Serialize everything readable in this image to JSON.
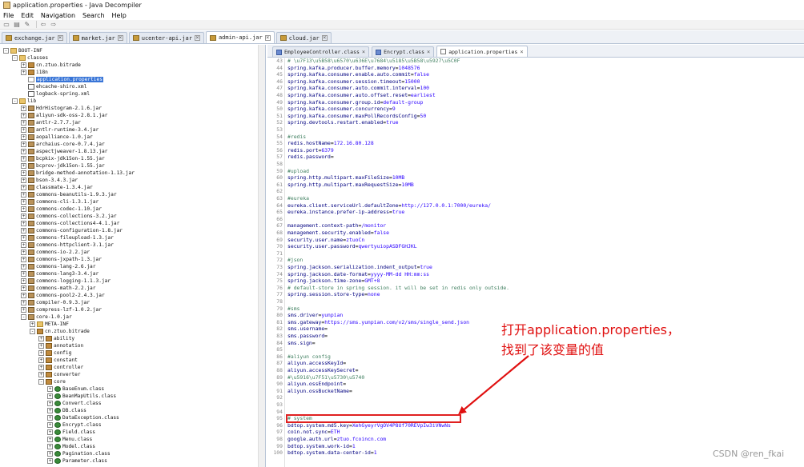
{
  "window": {
    "title": "application.properties - Java Decompiler"
  },
  "menu": [
    "File",
    "Edit",
    "Navigation",
    "Search",
    "Help"
  ],
  "toolbar_icons": [
    "open-icon",
    "folder-icon",
    "wand-icon",
    "back-icon",
    "forward-icon"
  ],
  "jar_tabs": [
    {
      "label": "exchange.jar",
      "active": false
    },
    {
      "label": "market.jar",
      "active": false
    },
    {
      "label": "ucenter-api.jar",
      "active": false
    },
    {
      "label": "admin-api.jar",
      "active": true
    },
    {
      "label": "cloud.jar",
      "active": false
    }
  ],
  "tree": [
    {
      "label": "BOOT-INF",
      "depth": 0,
      "icon": "folder",
      "exp": "-"
    },
    {
      "label": "classes",
      "depth": 1,
      "icon": "folder",
      "exp": "-"
    },
    {
      "label": "cn.ztuo.bitrade",
      "depth": 2,
      "icon": "pkg",
      "exp": "+"
    },
    {
      "label": "i18n",
      "depth": 2,
      "icon": "pkg",
      "exp": "+"
    },
    {
      "label": "application.properties",
      "depth": 2,
      "icon": "file",
      "exp": "",
      "selected": true
    },
    {
      "label": "ehcache-shiro.xml",
      "depth": 2,
      "icon": "xml",
      "exp": ""
    },
    {
      "label": "logback-spring.xml",
      "depth": 2,
      "icon": "xml",
      "exp": ""
    },
    {
      "label": "lib",
      "depth": 1,
      "icon": "folder",
      "exp": "-"
    },
    {
      "label": "HdrHistogram-2.1.6.jar",
      "depth": 2,
      "icon": "jar",
      "exp": "+"
    },
    {
      "label": "aliyun-sdk-oss-2.8.1.jar",
      "depth": 2,
      "icon": "jar",
      "exp": "+"
    },
    {
      "label": "antlr-2.7.7.jar",
      "depth": 2,
      "icon": "jar",
      "exp": "+"
    },
    {
      "label": "antlr-runtime-3.4.jar",
      "depth": 2,
      "icon": "jar",
      "exp": "+"
    },
    {
      "label": "aopalliance-1.0.jar",
      "depth": 2,
      "icon": "jar",
      "exp": "+"
    },
    {
      "label": "archaius-core-0.7.4.jar",
      "depth": 2,
      "icon": "jar",
      "exp": "+"
    },
    {
      "label": "aspectjweaver-1.8.13.jar",
      "depth": 2,
      "icon": "jar",
      "exp": "+"
    },
    {
      "label": "bcpkix-jdk15on-1.55.jar",
      "depth": 2,
      "icon": "jar",
      "exp": "+"
    },
    {
      "label": "bcprov-jdk15on-1.55.jar",
      "depth": 2,
      "icon": "jar",
      "exp": "+"
    },
    {
      "label": "bridge-method-annotation-1.13.jar",
      "depth": 2,
      "icon": "jar",
      "exp": "+"
    },
    {
      "label": "bson-3.4.3.jar",
      "depth": 2,
      "icon": "jar",
      "exp": "+"
    },
    {
      "label": "classmate-1.3.4.jar",
      "depth": 2,
      "icon": "jar",
      "exp": "+"
    },
    {
      "label": "commons-beanutils-1.9.3.jar",
      "depth": 2,
      "icon": "jar",
      "exp": "+"
    },
    {
      "label": "commons-cli-1.3.1.jar",
      "depth": 2,
      "icon": "jar",
      "exp": "+"
    },
    {
      "label": "commons-codec-1.10.jar",
      "depth": 2,
      "icon": "jar",
      "exp": "+"
    },
    {
      "label": "commons-collections-3.2.jar",
      "depth": 2,
      "icon": "jar",
      "exp": "+"
    },
    {
      "label": "commons-collections4-4.1.jar",
      "depth": 2,
      "icon": "jar",
      "exp": "+"
    },
    {
      "label": "commons-configuration-1.8.jar",
      "depth": 2,
      "icon": "jar",
      "exp": "+"
    },
    {
      "label": "commons-fileupload-1.3.jar",
      "depth": 2,
      "icon": "jar",
      "exp": "+"
    },
    {
      "label": "commons-httpclient-3.1.jar",
      "depth": 2,
      "icon": "jar",
      "exp": "+"
    },
    {
      "label": "commons-io-2.2.jar",
      "depth": 2,
      "icon": "jar",
      "exp": "+"
    },
    {
      "label": "commons-jxpath-1.3.jar",
      "depth": 2,
      "icon": "jar",
      "exp": "+"
    },
    {
      "label": "commons-lang-2.6.jar",
      "depth": 2,
      "icon": "jar",
      "exp": "+"
    },
    {
      "label": "commons-lang3-3.4.jar",
      "depth": 2,
      "icon": "jar",
      "exp": "+"
    },
    {
      "label": "commons-logging-1.1.3.jar",
      "depth": 2,
      "icon": "jar",
      "exp": "+"
    },
    {
      "label": "commons-math-2.2.jar",
      "depth": 2,
      "icon": "jar",
      "exp": "+"
    },
    {
      "label": "commons-pool2-2.4.3.jar",
      "depth": 2,
      "icon": "jar",
      "exp": "+"
    },
    {
      "label": "compiler-0.9.3.jar",
      "depth": 2,
      "icon": "jar",
      "exp": "+"
    },
    {
      "label": "compress-lzf-1.0.2.jar",
      "depth": 2,
      "icon": "jar",
      "exp": "+"
    },
    {
      "label": "core-1.0.jar",
      "depth": 2,
      "icon": "jar",
      "exp": "-"
    },
    {
      "label": "META-INF",
      "depth": 3,
      "icon": "folder",
      "exp": "+"
    },
    {
      "label": "cn.ztuo.bitrade",
      "depth": 3,
      "icon": "pkg",
      "exp": "-"
    },
    {
      "label": "ability",
      "depth": 4,
      "icon": "pkg",
      "exp": "+"
    },
    {
      "label": "annotation",
      "depth": 4,
      "icon": "pkg",
      "exp": "+"
    },
    {
      "label": "config",
      "depth": 4,
      "icon": "pkg",
      "exp": "+"
    },
    {
      "label": "constant",
      "depth": 4,
      "icon": "pkg",
      "exp": "+"
    },
    {
      "label": "controller",
      "depth": 4,
      "icon": "pkg",
      "exp": "+"
    },
    {
      "label": "converter",
      "depth": 4,
      "icon": "pkg",
      "exp": "+"
    },
    {
      "label": "core",
      "depth": 4,
      "icon": "pkg",
      "exp": "-"
    },
    {
      "label": "BaseEnum.class",
      "depth": 5,
      "icon": "cls",
      "exp": "+"
    },
    {
      "label": "BeanMapUtils.class",
      "depth": 5,
      "icon": "cls",
      "exp": "+"
    },
    {
      "label": "Convert.class",
      "depth": 5,
      "icon": "cls",
      "exp": "+"
    },
    {
      "label": "DB.class",
      "depth": 5,
      "icon": "cls",
      "exp": "+"
    },
    {
      "label": "DataException.class",
      "depth": 5,
      "icon": "cls",
      "exp": "+"
    },
    {
      "label": "Encrypt.class",
      "depth": 5,
      "icon": "cls",
      "exp": "+"
    },
    {
      "label": "Field.class",
      "depth": 5,
      "icon": "cls",
      "exp": "+"
    },
    {
      "label": "Menu.class",
      "depth": 5,
      "icon": "cls",
      "exp": "+"
    },
    {
      "label": "Model.class",
      "depth": 5,
      "icon": "cls",
      "exp": "+"
    },
    {
      "label": "Pagination.class",
      "depth": 5,
      "icon": "cls",
      "exp": "+"
    },
    {
      "label": "Parameter.class",
      "depth": 5,
      "icon": "cls",
      "exp": "+"
    }
  ],
  "editor_tabs": [
    {
      "label": "EmployeeController.class",
      "icon": "cls",
      "active": false
    },
    {
      "label": "Encrypt.class",
      "icon": "cls",
      "active": false
    },
    {
      "label": "application.properties",
      "icon": "prop",
      "active": true
    }
  ],
  "code": [
    {
      "n": "43",
      "t": "# \\u7F13\\u5B58\\u6570\\u636E\\u7684\\u5185\\u5B58\\u5927\\u5C0F"
    },
    {
      "n": "44",
      "t": "spring.kafka.producer.buffer.memory=1048576"
    },
    {
      "n": "45",
      "t": "spring.kafka.consumer.enable.auto.commit=false"
    },
    {
      "n": "46",
      "t": "spring.kafka.consumer.session.timeout=15000"
    },
    {
      "n": "47",
      "t": "spring.kafka.consumer.auto.commit.interval=100"
    },
    {
      "n": "48",
      "t": "spring.kafka.consumer.auto.offset.reset=earliest"
    },
    {
      "n": "49",
      "t": "spring.kafka.consumer.group.id=default-group"
    },
    {
      "n": "50",
      "t": "spring.kafka.consumer.concurrency=9"
    },
    {
      "n": "51",
      "t": "spring.kafka.consumer.maxPollRecordsConfig=50"
    },
    {
      "n": "52",
      "t": "spring.devtools.restart.enabled=true"
    },
    {
      "n": "53",
      "t": ""
    },
    {
      "n": "54",
      "t": "#redis"
    },
    {
      "n": "55",
      "t": "redis.hostName=172.16.80.128"
    },
    {
      "n": "56",
      "t": "redis.port=6379"
    },
    {
      "n": "57",
      "t": "redis.password="
    },
    {
      "n": "58",
      "t": ""
    },
    {
      "n": "59",
      "t": "#upload"
    },
    {
      "n": "60",
      "t": "spring.http.multipart.maxFileSize=10MB"
    },
    {
      "n": "61",
      "t": "spring.http.multipart.maxRequestSize=10MB"
    },
    {
      "n": "62",
      "t": ""
    },
    {
      "n": "63",
      "t": "#eureka"
    },
    {
      "n": "64",
      "t": "eureka.client.serviceUrl.defaultZone=http://127.0.0.1:7000/eureka/"
    },
    {
      "n": "65",
      "t": "eureka.instance.prefer-ip-address=true"
    },
    {
      "n": "66",
      "t": ""
    },
    {
      "n": "67",
      "t": "management.context-path=/monitor"
    },
    {
      "n": "68",
      "t": "management.security.enabled=false"
    },
    {
      "n": "69",
      "t": "security.user.name=ztuoCn"
    },
    {
      "n": "70",
      "t": "security.user.password=qwertyuiopASDFGHJKL"
    },
    {
      "n": "71",
      "t": ""
    },
    {
      "n": "72",
      "t": "#json"
    },
    {
      "n": "73",
      "t": "spring.jackson.serialization.indent_output=true"
    },
    {
      "n": "74",
      "t": "spring.jackson.date-format=yyyy-MM-dd HH:mm:ss"
    },
    {
      "n": "75",
      "t": "spring.jackson.time-zone=GMT+8"
    },
    {
      "n": "76",
      "t": "# default-store in spring session. it will be set in redis only outside."
    },
    {
      "n": "77",
      "t": "spring.session.store-type=none"
    },
    {
      "n": "78",
      "t": ""
    },
    {
      "n": "79",
      "t": "#sms"
    },
    {
      "n": "80",
      "t": "sms.driver=yunpian"
    },
    {
      "n": "81",
      "t": "sms.gateway=https://sms.yunpian.com/v2/sms/single_send.json"
    },
    {
      "n": "82",
      "t": "sms.username="
    },
    {
      "n": "83",
      "t": "sms.password="
    },
    {
      "n": "84",
      "t": "sms.sign="
    },
    {
      "n": "85",
      "t": ""
    },
    {
      "n": "86",
      "t": "#aliyun config"
    },
    {
      "n": "87",
      "t": "aliyun.accessKeyId="
    },
    {
      "n": "88",
      "t": "aliyun.accessKeySecret="
    },
    {
      "n": "89",
      "t": "#\\u5916\\u7F51\\u5730\\u5740"
    },
    {
      "n": "90",
      "t": "aliyun.ossEndpoint="
    },
    {
      "n": "91",
      "t": "aliyun.ossBucketName="
    },
    {
      "n": "92",
      "t": ""
    },
    {
      "n": "93",
      "t": ""
    },
    {
      "n": "94",
      "t": ""
    },
    {
      "n": "95",
      "t": "# system"
    },
    {
      "n": "96",
      "t": "bdtop.system.md5.key=XehGyeyrVgOV4P8Uf70REVpIw3iVNwNs"
    },
    {
      "n": "97",
      "t": "coin.not.sync=ETH"
    },
    {
      "n": "98",
      "t": "google.auth.url=ztuo.fcoincn.com"
    },
    {
      "n": "99",
      "t": "bdtop.system.work-id=1"
    },
    {
      "n": "100",
      "t": "bdtop.system.data-center-id=1"
    }
  ],
  "annotation": {
    "line1": "打开application.properties，",
    "line2": "找到了该变量的值",
    "color": "#e01010"
  },
  "watermark": "CSDN @ren_fkai"
}
